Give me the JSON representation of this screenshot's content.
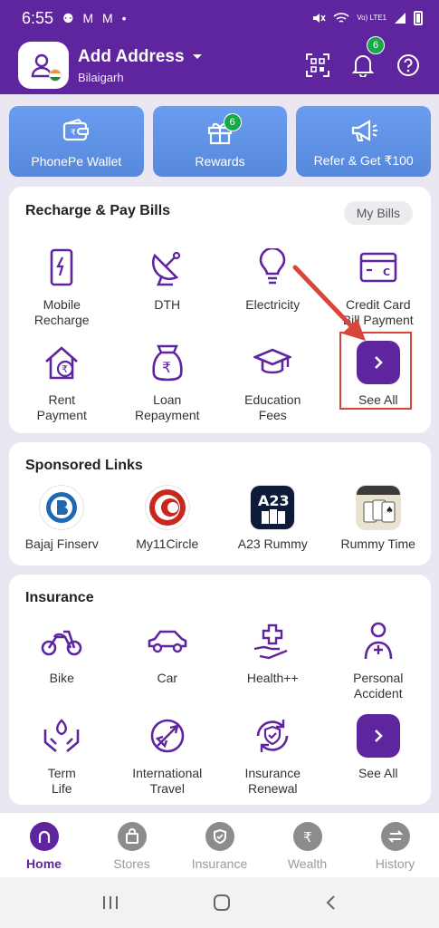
{
  "status_bar": {
    "time": "6:55",
    "left_icons": "⚉ M M •",
    "network_label": "Vo) LTE1"
  },
  "header": {
    "title": "Add Address",
    "location": "Bilaigarh",
    "notification_count": "6"
  },
  "quick_tiles": [
    {
      "label": "PhonePe Wallet",
      "icon": "wallet-icon"
    },
    {
      "label": "Rewards",
      "icon": "gift-icon",
      "badge": "6"
    },
    {
      "label": "Refer & Get ₹100",
      "icon": "megaphone-icon"
    }
  ],
  "recharge": {
    "title": "Recharge & Pay Bills",
    "my_bills": "My Bills",
    "items": [
      {
        "label": "Mobile\nRecharge",
        "icon": "mobile-icon"
      },
      {
        "label": "DTH",
        "icon": "satellite-dish-icon"
      },
      {
        "label": "Electricity",
        "icon": "bulb-icon"
      },
      {
        "label": "Credit Card\nBill Payment",
        "icon": "credit-card-icon"
      },
      {
        "label": "Rent\nPayment",
        "icon": "house-rupee-icon"
      },
      {
        "label": "Loan\nRepayment",
        "icon": "money-bag-icon"
      },
      {
        "label": "Education\nFees",
        "icon": "graduation-cap-icon"
      },
      {
        "label": "See All",
        "icon": "chevron-right-icon"
      }
    ]
  },
  "sponsored": {
    "title": "Sponsored Links",
    "items": [
      {
        "label": "Bajaj Finserv",
        "icon": "bajaj-logo-icon"
      },
      {
        "label": "My11Circle",
        "icon": "my11circle-logo-icon"
      },
      {
        "label": "A23 Rummy",
        "icon": "a23-logo-icon"
      },
      {
        "label": "Rummy Time",
        "icon": "rummy-time-logo-icon"
      }
    ]
  },
  "insurance": {
    "title": "Insurance",
    "items": [
      {
        "label": "Bike",
        "icon": "bike-icon"
      },
      {
        "label": "Car",
        "icon": "car-icon"
      },
      {
        "label": "Health++",
        "icon": "health-icon"
      },
      {
        "label": "Personal\nAccident",
        "icon": "person-icon"
      },
      {
        "label": "Term\nLife",
        "icon": "term-life-icon"
      },
      {
        "label": "International\nTravel",
        "icon": "plane-icon"
      },
      {
        "label": "Insurance\nRenewal",
        "icon": "renewal-icon"
      },
      {
        "label": "See All",
        "icon": "chevron-right-icon"
      }
    ]
  },
  "bottom_nav": [
    {
      "label": "Home",
      "icon": "home-icon",
      "active": true
    },
    {
      "label": "Stores",
      "icon": "bag-icon"
    },
    {
      "label": "Insurance",
      "icon": "shield-icon"
    },
    {
      "label": "Wealth",
      "icon": "rupee-icon"
    },
    {
      "label": "History",
      "icon": "swap-icon"
    }
  ],
  "colors": {
    "brand": "#5f259f",
    "tile": "#5f8fe0",
    "badge": "#17a84a",
    "highlight": "#d9453a"
  }
}
